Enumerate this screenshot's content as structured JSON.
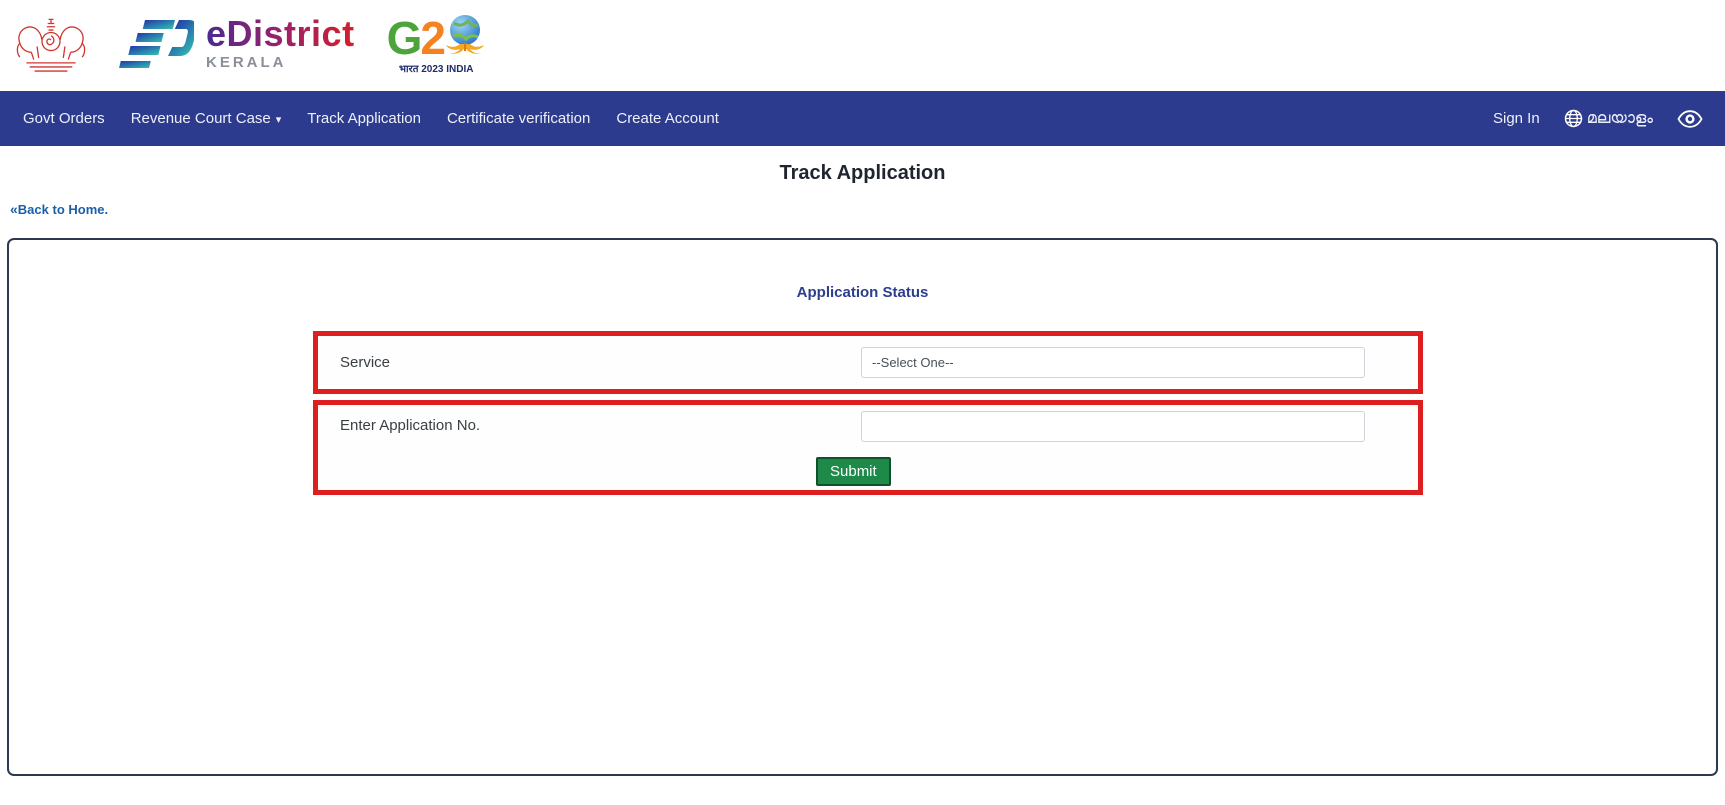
{
  "header": {
    "edistrict": {
      "name": "eDistrict",
      "subtitle": "KERALA"
    },
    "g20": {
      "g": "G",
      "two": "2",
      "caption": "भारत 2023 INDIA"
    }
  },
  "navbar": {
    "items": [
      {
        "label": "Govt Orders"
      },
      {
        "label": "Revenue Court Case",
        "dropdown": true
      },
      {
        "label": "Track Application"
      },
      {
        "label": "Certificate verification"
      },
      {
        "label": "Create Account"
      }
    ],
    "sign_in": "Sign In",
    "language": "മലയാളം"
  },
  "page": {
    "title": "Track Application",
    "back_link": "Back to Home."
  },
  "form": {
    "heading": "Application Status",
    "rows": [
      {
        "label": "Service",
        "control": "select",
        "value": "--Select One--"
      },
      {
        "label": "Enter Application No.",
        "control": "input",
        "value": ""
      }
    ],
    "submit": "Submit"
  },
  "icons": {
    "dropdown_caret": "▾",
    "back_chevrons": "«"
  },
  "colors": {
    "navbar_background": "#2c3b8e",
    "highlight_red": "#df1f1f",
    "submit_green": "#1d8a4a",
    "link_blue": "#1b5fa8",
    "panel_border": "#2b3a52",
    "heading_blue": "#2d3e8f",
    "edistrict_gradient_start": "#4b2a8f",
    "edistrict_gradient_end": "#d41f2c"
  }
}
